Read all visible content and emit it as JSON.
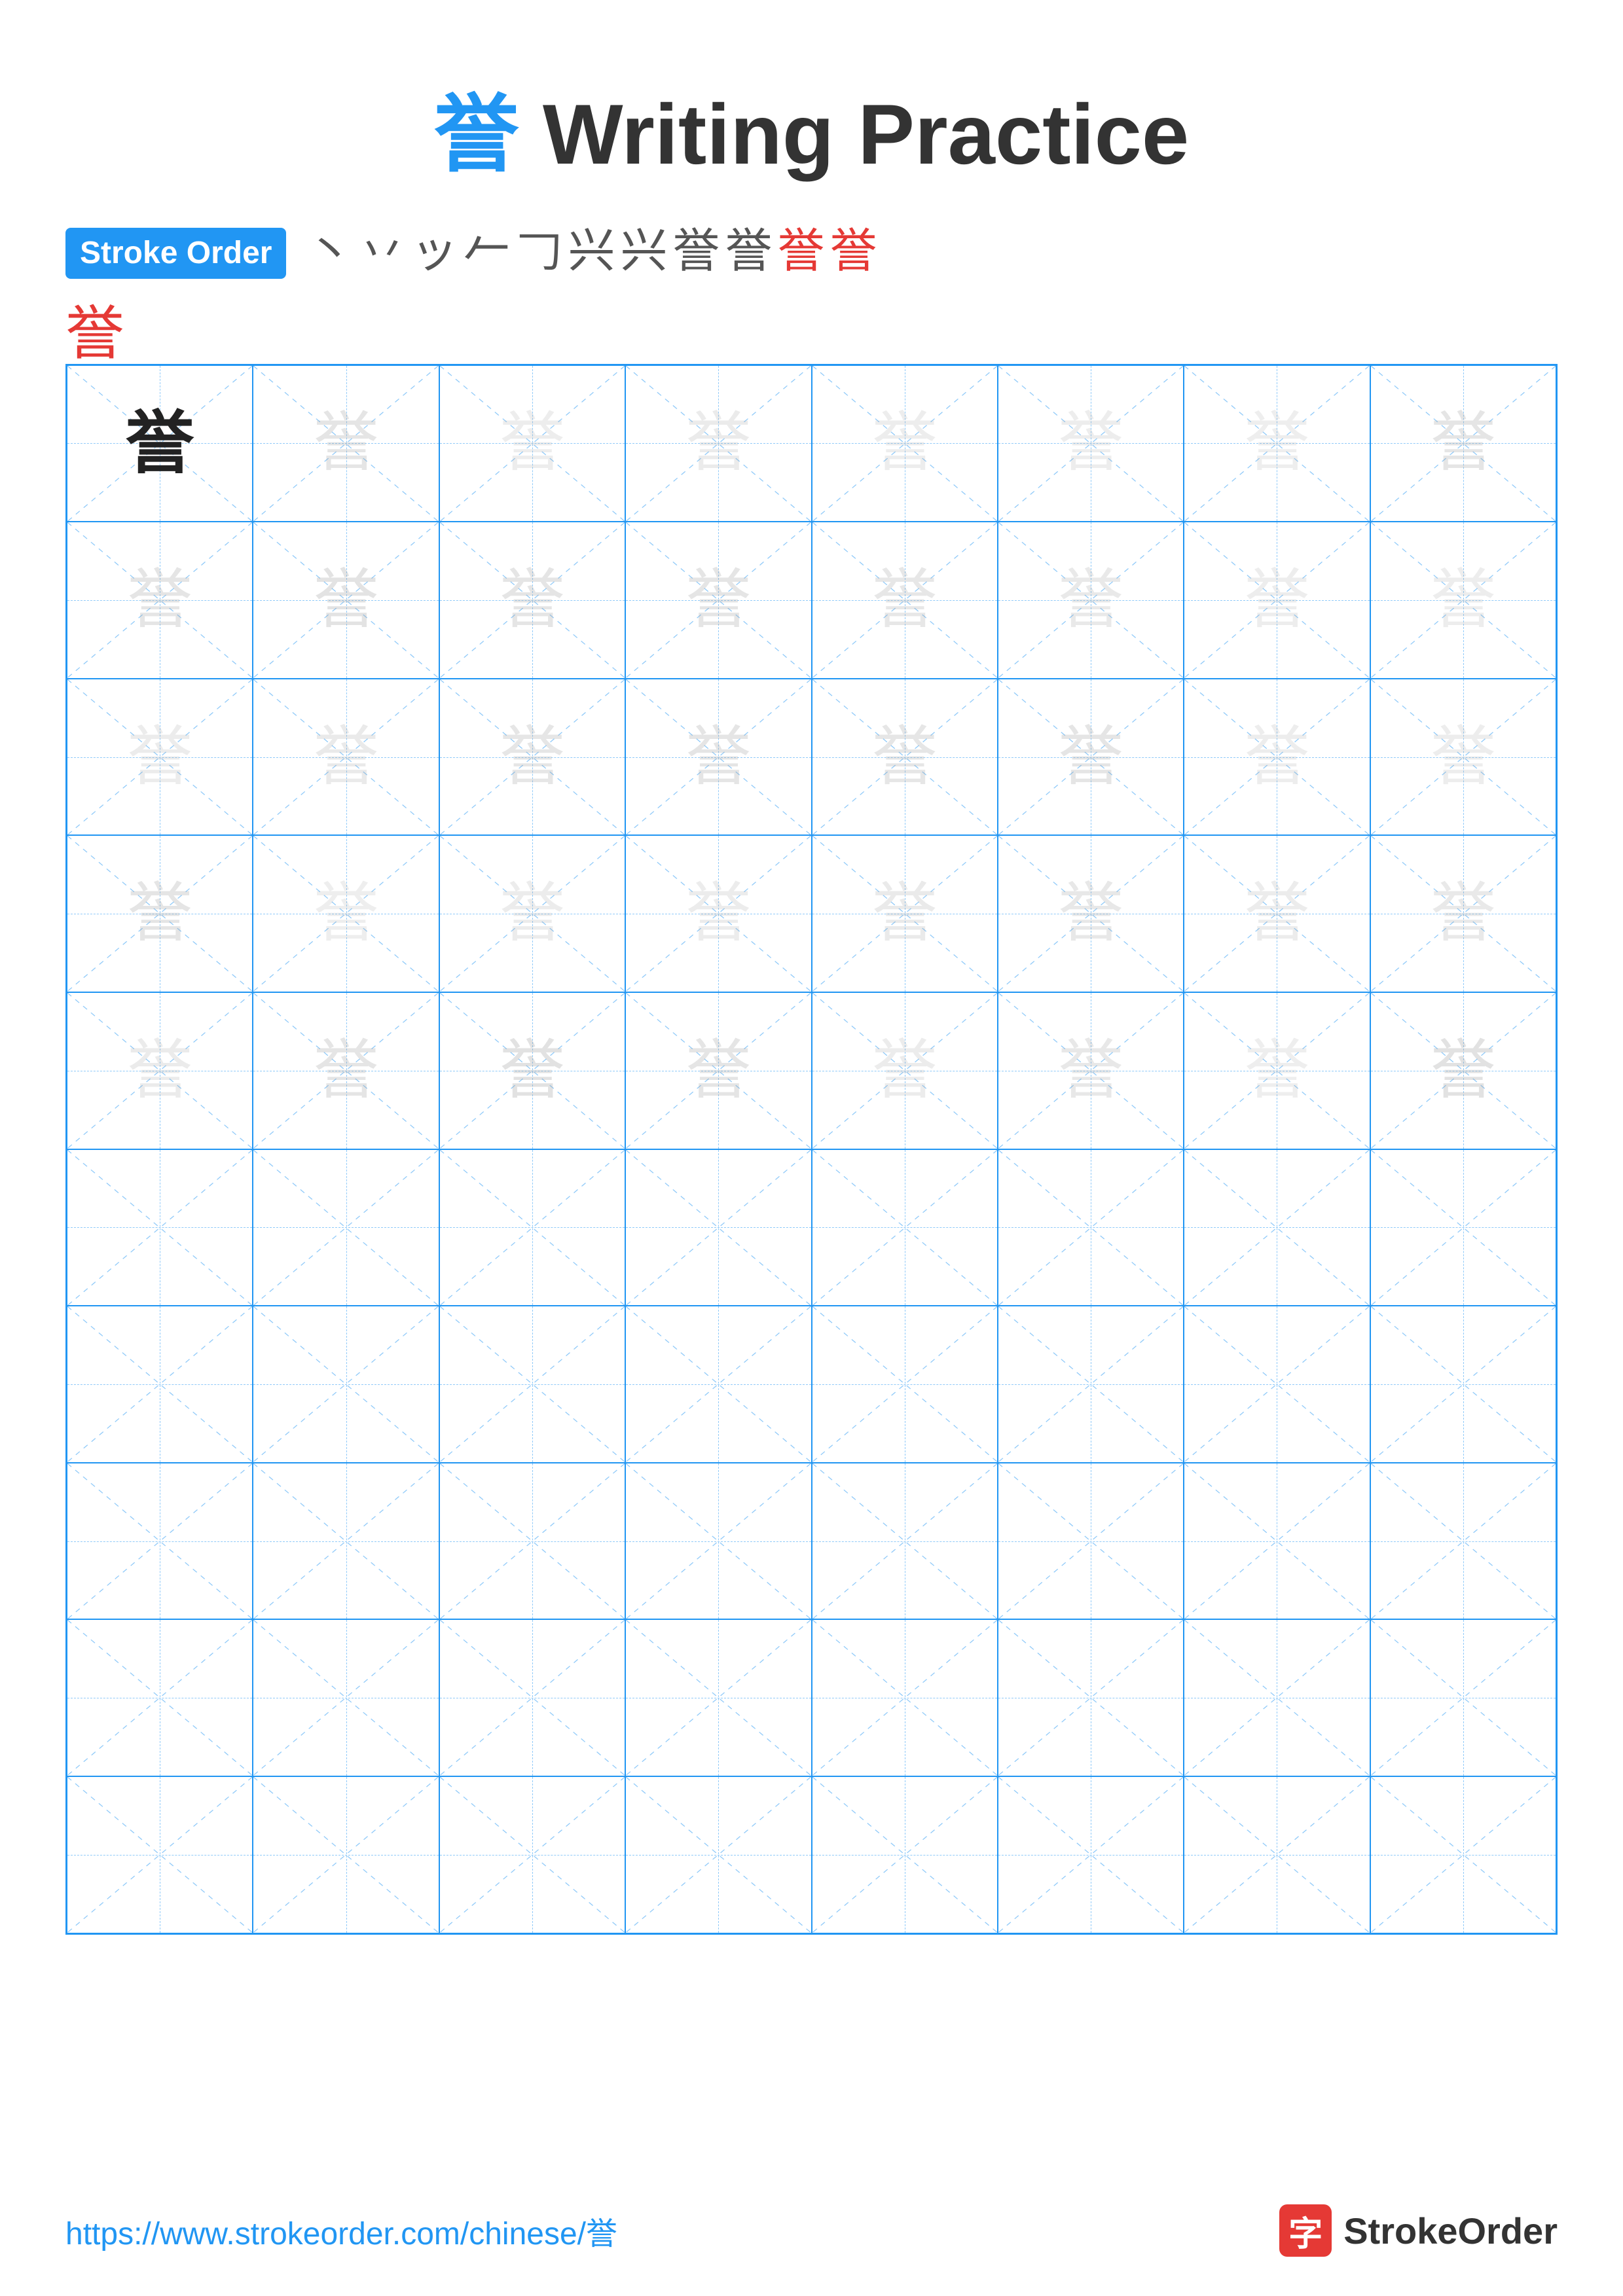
{
  "title": {
    "char": "誉",
    "text": " Writing Practice"
  },
  "stroke_order": {
    "badge_label": "Stroke Order",
    "steps": [
      "丶",
      "丶",
      "ッ",
      "乛",
      "𠃊",
      "兴",
      "兴",
      "兴乂",
      "誉乂",
      "誉",
      "誉",
      "誉"
    ],
    "final_char": "誉"
  },
  "grid": {
    "cols": 8,
    "rows": 10,
    "char": "誉",
    "filled_rows": 5
  },
  "footer": {
    "url": "https://www.strokeorder.com/chinese/誉",
    "brand_char": "字",
    "brand_name": "StrokeOrder"
  }
}
